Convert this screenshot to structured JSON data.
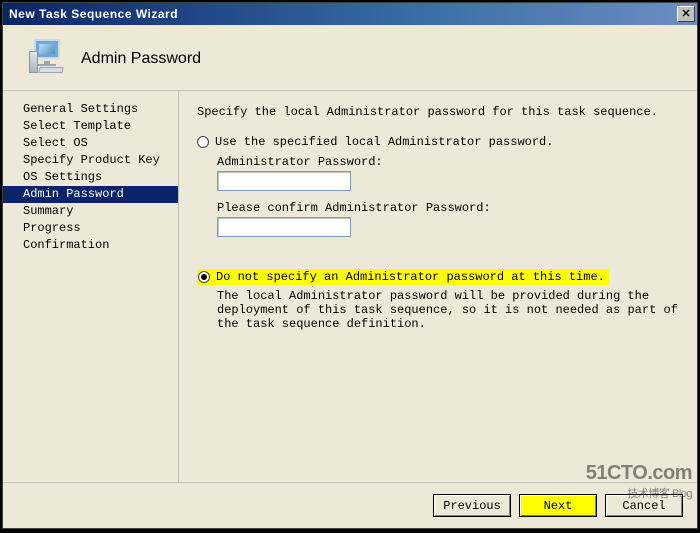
{
  "window": {
    "title": "New Task Sequence Wizard"
  },
  "header": {
    "heading": "Admin Password"
  },
  "sidebar": {
    "items": [
      {
        "label": "General Settings",
        "active": false
      },
      {
        "label": "Select Template",
        "active": false
      },
      {
        "label": "Select OS",
        "active": false
      },
      {
        "label": "Specify Product Key",
        "active": false
      },
      {
        "label": "OS Settings",
        "active": false
      },
      {
        "label": "Admin Password",
        "active": true
      },
      {
        "label": "Summary",
        "active": false
      },
      {
        "label": "Progress",
        "active": false
      },
      {
        "label": "Confirmation",
        "active": false
      }
    ]
  },
  "content": {
    "instruction": "Specify the local Administrator password for this task sequence.",
    "opt1": {
      "label": "Use the specified local Administrator password.",
      "selected": false,
      "pw_label": "Administrator Password:",
      "pw_value": "",
      "confirm_label": "Please confirm Administrator Password:",
      "confirm_value": ""
    },
    "opt2": {
      "label": "Do not specify an Administrator password at this time.",
      "selected": true,
      "explain": "The local Administrator password will be provided during the deployment of this task sequence, so it is not needed as part of the task sequence definition."
    }
  },
  "footer": {
    "previous": "Previous",
    "next": "Next",
    "cancel": "Cancel"
  },
  "watermark": {
    "line1": "51CTO.com",
    "line2": "技术博客  Blog"
  }
}
